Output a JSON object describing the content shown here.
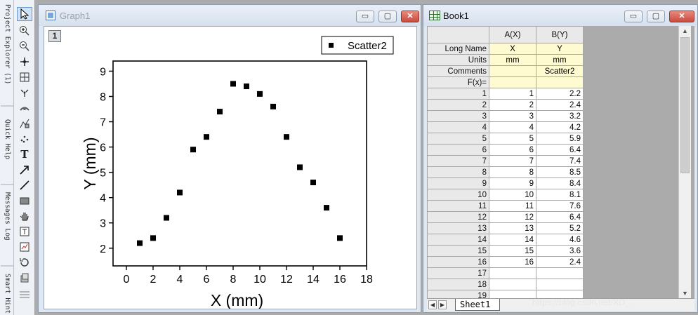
{
  "dock": {
    "tabs": [
      "Project Explorer (1)",
      "Quick Help",
      "Messages Log",
      "Smart Hint"
    ]
  },
  "tools": {
    "icons": [
      "pointer-icon",
      "zoom-in-icon",
      "zoom-out-icon",
      "screen-reader-icon",
      "data-reader-icon",
      "data-selector-icon",
      "draw-data-icon",
      "region-mask-icon",
      "scatter-points-icon",
      "text-tool-icon",
      "arrow-tool-icon",
      "line-tool-icon",
      "rectangle-tool-icon",
      "pan-tool-icon",
      "add-text-icon",
      "add-graph-icon",
      "rotate-icon",
      "layer-icon"
    ]
  },
  "graph_window": {
    "title": "Graph1",
    "layer_badge": "1",
    "buttons": {
      "minimize": "▭",
      "maximize": "▢",
      "close": "✕"
    }
  },
  "chart_data": {
    "type": "scatter",
    "series": [
      {
        "name": "Scatter2",
        "x": [
          1,
          2,
          3,
          4,
          5,
          6,
          7,
          8,
          9,
          10,
          11,
          12,
          13,
          14,
          15,
          16
        ],
        "y": [
          2.2,
          2.4,
          3.2,
          4.2,
          5.9,
          6.4,
          7.4,
          8.5,
          8.4,
          8.1,
          7.6,
          6.4,
          5.2,
          4.6,
          3.6,
          2.4
        ]
      }
    ],
    "xlabel": "X (mm)",
    "ylabel": "Y (mm)",
    "xlim": [
      -1,
      18
    ],
    "ylim": [
      1.3,
      9.4
    ],
    "xticks": [
      0,
      2,
      4,
      6,
      8,
      10,
      12,
      14,
      16,
      18
    ],
    "yticks": [
      2,
      3,
      4,
      5,
      6,
      7,
      8,
      9
    ],
    "grid": false,
    "legend": "top-right",
    "marker_color": "#000000"
  },
  "book_window": {
    "title": "Book1",
    "buttons": {
      "minimize": "▭",
      "maximize": "▢",
      "close": "✕"
    },
    "columns": [
      "A(X)",
      "B(Y)"
    ],
    "label_rows": [
      {
        "name": "Long Name",
        "values": [
          "X",
          "Y"
        ]
      },
      {
        "name": "Units",
        "values": [
          "mm",
          "mm"
        ]
      },
      {
        "name": "Comments",
        "values": [
          "",
          "Scatter2"
        ]
      },
      {
        "name": "F(x)=",
        "values": [
          "",
          ""
        ]
      }
    ],
    "rows": [
      {
        "index": "1",
        "a": "1",
        "b": "2.2"
      },
      {
        "index": "2",
        "a": "2",
        "b": "2.4"
      },
      {
        "index": "3",
        "a": "3",
        "b": "3.2"
      },
      {
        "index": "4",
        "a": "4",
        "b": "4.2"
      },
      {
        "index": "5",
        "a": "5",
        "b": "5.9"
      },
      {
        "index": "6",
        "a": "6",
        "b": "6.4"
      },
      {
        "index": "7",
        "a": "7",
        "b": "7.4"
      },
      {
        "index": "8",
        "a": "8",
        "b": "8.5"
      },
      {
        "index": "9",
        "a": "9",
        "b": "8.4"
      },
      {
        "index": "10",
        "a": "10",
        "b": "8.1"
      },
      {
        "index": "11",
        "a": "11",
        "b": "7.6"
      },
      {
        "index": "12",
        "a": "12",
        "b": "6.4"
      },
      {
        "index": "13",
        "a": "13",
        "b": "5.2"
      },
      {
        "index": "14",
        "a": "14",
        "b": "4.6"
      },
      {
        "index": "15",
        "a": "15",
        "b": "3.6"
      },
      {
        "index": "16",
        "a": "16",
        "b": "2.4"
      },
      {
        "index": "17",
        "a": "",
        "b": ""
      },
      {
        "index": "18",
        "a": "",
        "b": ""
      },
      {
        "index": "19",
        "a": "",
        "b": ""
      }
    ],
    "sheet_tab": "Sheet1",
    "nav": {
      "first": "|◀",
      "prev": "◀",
      "next": "▶",
      "last": "▶|"
    }
  },
  "watermark": "https://blog.csdn.net/XD_..."
}
